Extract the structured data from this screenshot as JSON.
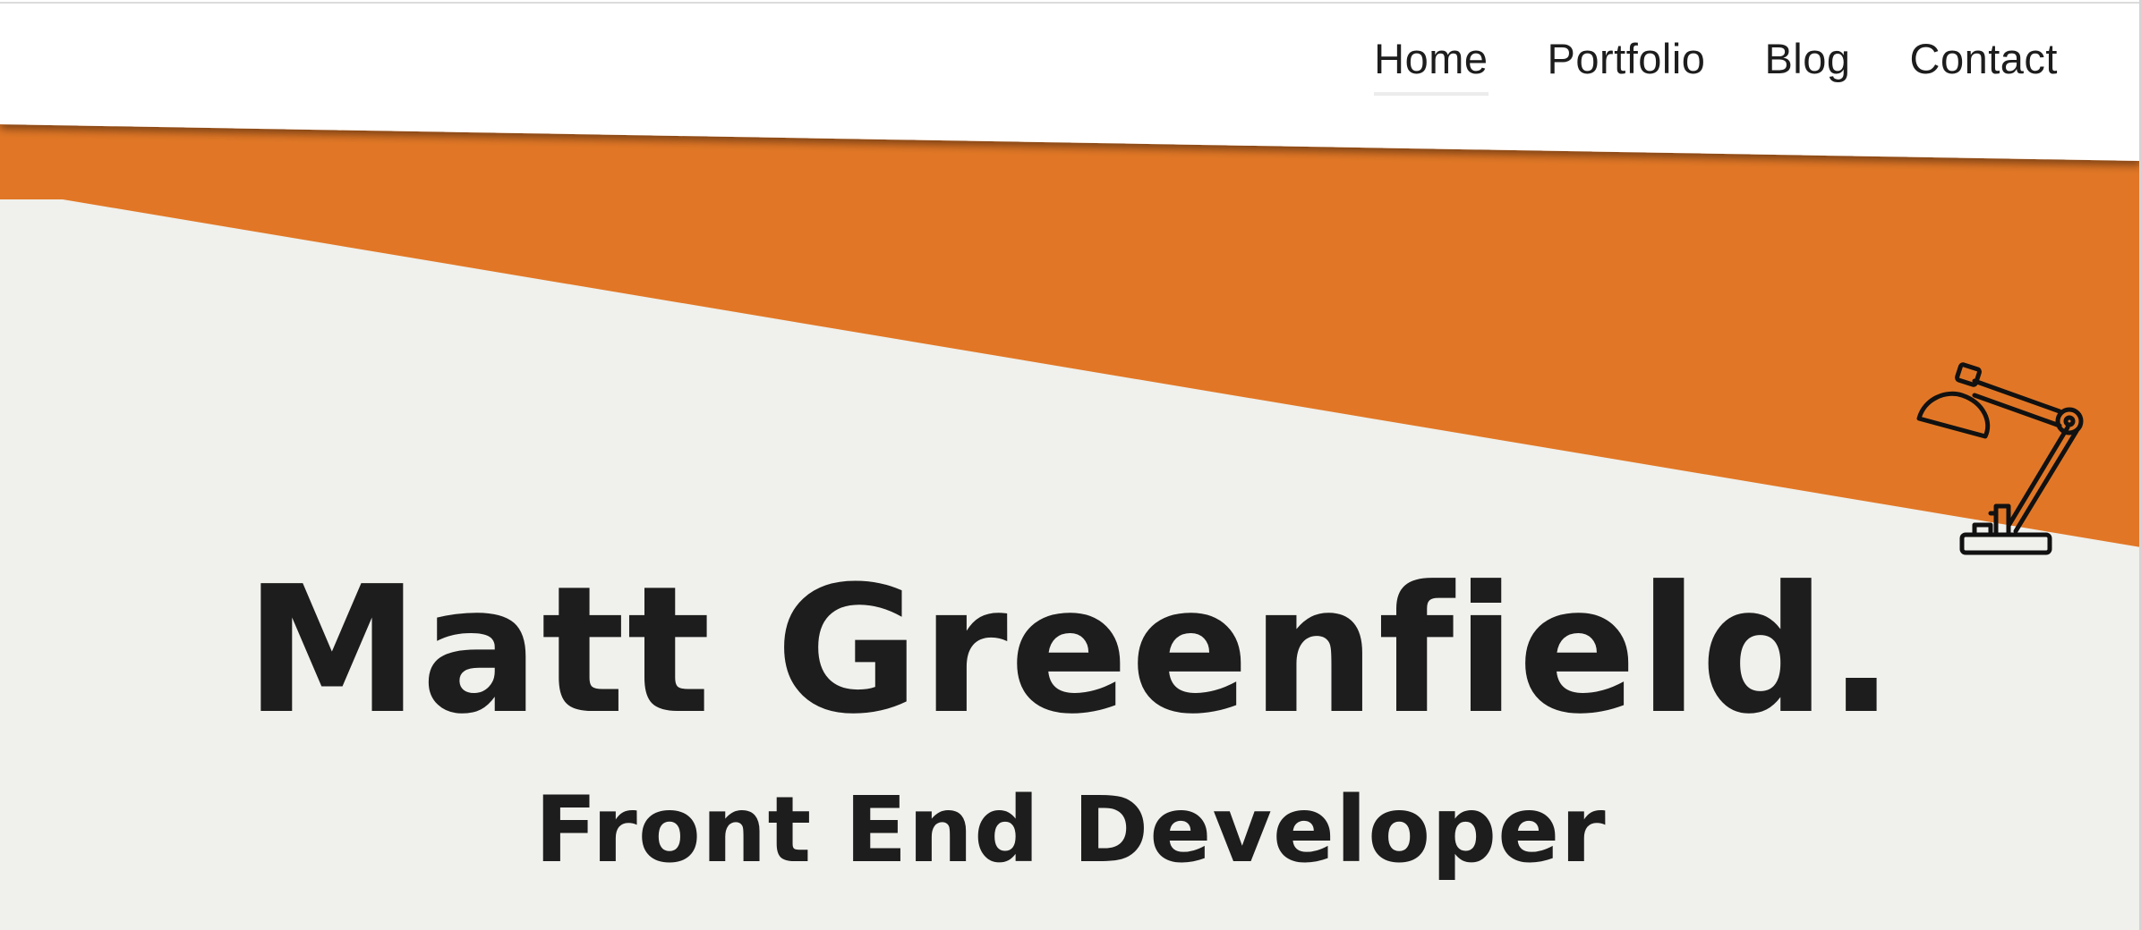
{
  "nav": {
    "items": [
      {
        "label": "Home",
        "active": true
      },
      {
        "label": "Portfolio",
        "active": false
      },
      {
        "label": "Blog",
        "active": false
      },
      {
        "label": "Contact",
        "active": false
      }
    ]
  },
  "hero": {
    "name": "Matt Greenfield.",
    "role": "Front End Developer",
    "illustration": "desk-lamp-icon"
  },
  "colors": {
    "accent": "#e17726",
    "background": "#f0f0ec",
    "header": "#ffffff",
    "text": "#1d1d1d"
  }
}
